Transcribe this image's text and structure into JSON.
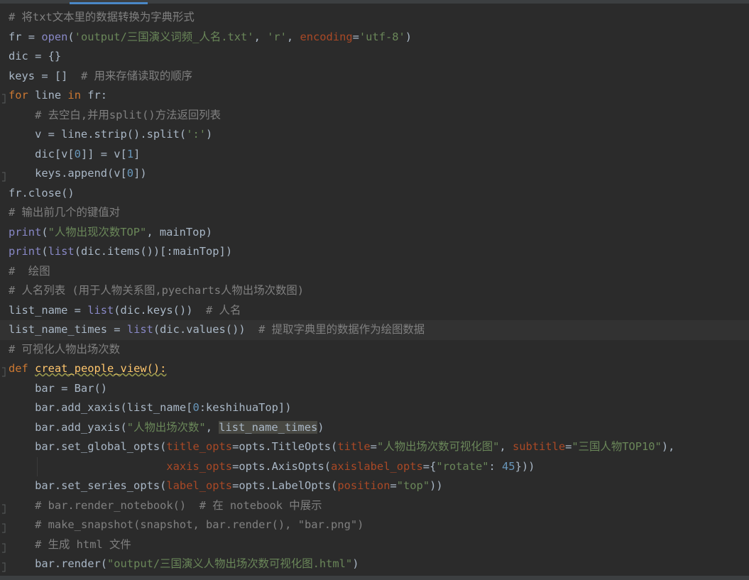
{
  "editor": {
    "lines": [
      [
        {
          "t": "# 将txt文本里的数据转换为字典形式",
          "c": "comment"
        }
      ],
      [
        {
          "t": "fr = ",
          "c": "plain"
        },
        {
          "t": "open",
          "c": "builtin"
        },
        {
          "t": "(",
          "c": "plain"
        },
        {
          "t": "'output/三国演义词频_人名.txt'",
          "c": "string"
        },
        {
          "t": ", ",
          "c": "plain"
        },
        {
          "t": "'r'",
          "c": "string"
        },
        {
          "t": ", ",
          "c": "plain"
        },
        {
          "t": "encoding",
          "c": "param"
        },
        {
          "t": "=",
          "c": "plain"
        },
        {
          "t": "'utf-8'",
          "c": "string"
        },
        {
          "t": ")",
          "c": "plain"
        }
      ],
      [
        {
          "t": "dic = {}",
          "c": "plain"
        }
      ],
      [
        {
          "t": "keys = []  ",
          "c": "plain"
        },
        {
          "t": "# 用来存储读取的顺序",
          "c": "comment"
        }
      ],
      [
        {
          "t": "for",
          "c": "keyword"
        },
        {
          "t": " line ",
          "c": "plain"
        },
        {
          "t": "in",
          "c": "keyword"
        },
        {
          "t": " fr:",
          "c": "plain"
        }
      ],
      [
        {
          "t": "    ",
          "c": "plain"
        },
        {
          "t": "# 去空白,并用split()方法返回列表",
          "c": "comment"
        }
      ],
      [
        {
          "t": "    v = line.strip().split(",
          "c": "plain"
        },
        {
          "t": "':'",
          "c": "string"
        },
        {
          "t": ")",
          "c": "plain"
        }
      ],
      [
        {
          "t": "    dic[v[",
          "c": "plain"
        },
        {
          "t": "0",
          "c": "number"
        },
        {
          "t": "]] = v[",
          "c": "plain"
        },
        {
          "t": "1",
          "c": "number"
        },
        {
          "t": "]",
          "c": "plain"
        }
      ],
      [
        {
          "t": "    keys.append(v[",
          "c": "plain"
        },
        {
          "t": "0",
          "c": "number"
        },
        {
          "t": "])",
          "c": "plain"
        }
      ],
      [
        {
          "t": "fr.close()",
          "c": "plain"
        }
      ],
      [
        {
          "t": "# 输出前几个的键值对",
          "c": "comment"
        }
      ],
      [
        {
          "t": "print",
          "c": "builtin"
        },
        {
          "t": "(",
          "c": "plain"
        },
        {
          "t": "\"人物出现次数TOP\"",
          "c": "string"
        },
        {
          "t": ", mainTop)",
          "c": "plain"
        }
      ],
      [
        {
          "t": "print",
          "c": "builtin"
        },
        {
          "t": "(",
          "c": "plain"
        },
        {
          "t": "list",
          "c": "builtin"
        },
        {
          "t": "(dic.items())[:mainTop])",
          "c": "plain"
        }
      ],
      [
        {
          "t": "#  绘图",
          "c": "comment"
        }
      ],
      [
        {
          "t": "# 人名列表 (用于人物关系图,pyecharts人物出场次数图)",
          "c": "comment"
        }
      ],
      [
        {
          "t": "list_name = ",
          "c": "plain"
        },
        {
          "t": "list",
          "c": "builtin"
        },
        {
          "t": "(dic.keys())  ",
          "c": "plain"
        },
        {
          "t": "# 人名",
          "c": "comment"
        }
      ],
      [
        {
          "t": "list_name_times = ",
          "c": "plain"
        },
        {
          "t": "list",
          "c": "builtin"
        },
        {
          "t": "(dic.values())  ",
          "c": "plain"
        },
        {
          "t": "# 提取字典里的数据作为绘图数据",
          "c": "comment"
        }
      ],
      [
        {
          "t": "# 可视化人物出场次数",
          "c": "comment"
        }
      ],
      [
        {
          "t": "def",
          "c": "keyword"
        },
        {
          "t": " ",
          "c": "plain"
        },
        {
          "t": "creat_people_view():",
          "c": "func"
        }
      ],
      [
        {
          "t": "    bar = Bar()",
          "c": "plain"
        }
      ],
      [
        {
          "t": "    bar.add_xaxis(list_name[",
          "c": "plain"
        },
        {
          "t": "0",
          "c": "number"
        },
        {
          "t": ":keshihuaTop])",
          "c": "plain"
        }
      ],
      [
        {
          "t": "    bar.add_yaxis(",
          "c": "plain"
        },
        {
          "t": "\"人物出场次数\"",
          "c": "string"
        },
        {
          "t": ", ",
          "c": "plain"
        },
        {
          "t": "list_name_times",
          "c": "highlight"
        },
        {
          "t": ")",
          "c": "plain"
        }
      ],
      [
        {
          "t": "    bar.set_global_opts(",
          "c": "plain"
        },
        {
          "t": "title_opts",
          "c": "param"
        },
        {
          "t": "=opts.TitleOpts(",
          "c": "plain"
        },
        {
          "t": "title",
          "c": "param"
        },
        {
          "t": "=",
          "c": "plain"
        },
        {
          "t": "\"人物出场次数可视化图\"",
          "c": "string"
        },
        {
          "t": ", ",
          "c": "plain"
        },
        {
          "t": "subtitle",
          "c": "param"
        },
        {
          "t": "=",
          "c": "plain"
        },
        {
          "t": "\"三国人物TOP10\"",
          "c": "string"
        },
        {
          "t": "),",
          "c": "plain"
        }
      ],
      [
        {
          "t": "                        ",
          "c": "plain"
        },
        {
          "t": "xaxis_opts",
          "c": "param"
        },
        {
          "t": "=opts.AxisOpts(",
          "c": "plain"
        },
        {
          "t": "axislabel_opts",
          "c": "param"
        },
        {
          "t": "={",
          "c": "plain"
        },
        {
          "t": "\"rotate\"",
          "c": "string"
        },
        {
          "t": ": ",
          "c": "plain"
        },
        {
          "t": "45",
          "c": "number"
        },
        {
          "t": "}))",
          "c": "plain"
        }
      ],
      [
        {
          "t": "    bar.set_series_opts(",
          "c": "plain"
        },
        {
          "t": "label_opts",
          "c": "param"
        },
        {
          "t": "=opts.LabelOpts(",
          "c": "plain"
        },
        {
          "t": "position",
          "c": "param"
        },
        {
          "t": "=",
          "c": "plain"
        },
        {
          "t": "\"top\"",
          "c": "string"
        },
        {
          "t": "))",
          "c": "plain"
        }
      ],
      [
        {
          "t": "    ",
          "c": "plain"
        },
        {
          "t": "# bar.render_notebook()  # 在 notebook 中展示",
          "c": "comment"
        }
      ],
      [
        {
          "t": "    ",
          "c": "plain"
        },
        {
          "t": "# make_snapshot(snapshot, bar.render(), \"bar.png\")",
          "c": "comment"
        }
      ],
      [
        {
          "t": "    ",
          "c": "plain"
        },
        {
          "t": "# 生成 html 文件",
          "c": "comment"
        }
      ],
      [
        {
          "t": "    bar.render(",
          "c": "plain"
        },
        {
          "t": "\"output/三国演义人物出场次数可视化图.html\"",
          "c": "string"
        },
        {
          "t": ")",
          "c": "plain"
        }
      ]
    ]
  }
}
